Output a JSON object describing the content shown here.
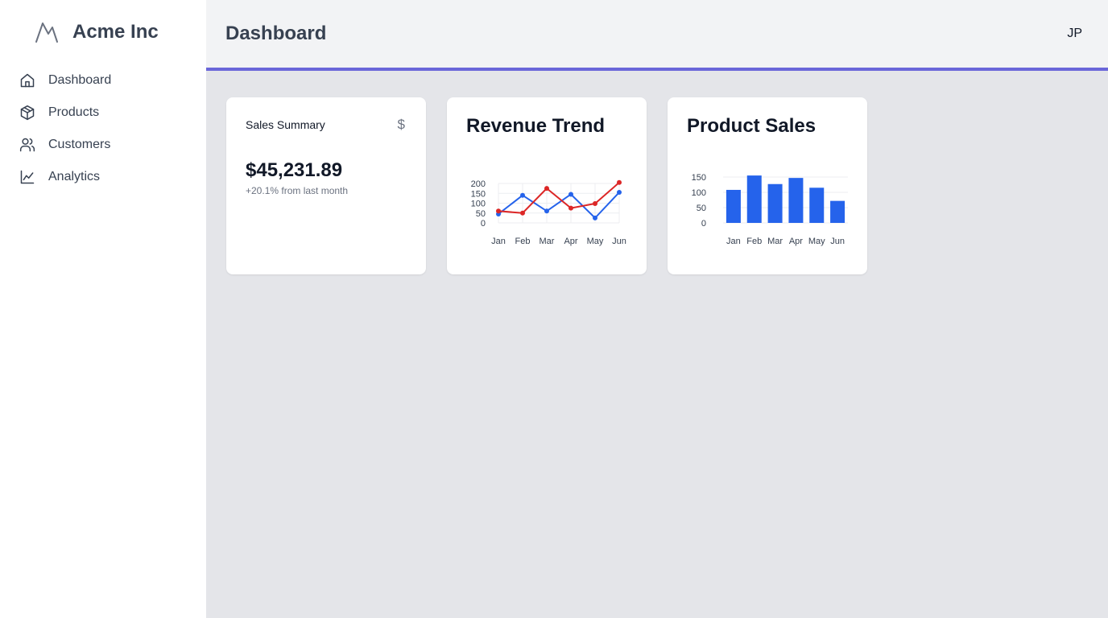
{
  "app": {
    "name": "Acme Inc"
  },
  "icons": {
    "brand": "mountain-icon",
    "dashboard": "home-icon",
    "products": "package-icon",
    "customers": "users-icon",
    "analytics": "line-chart-icon",
    "sales": "dollar-icon"
  },
  "sidebar": {
    "items": [
      {
        "label": "Dashboard"
      },
      {
        "label": "Products"
      },
      {
        "label": "Customers"
      },
      {
        "label": "Analytics"
      }
    ]
  },
  "header": {
    "title": "Dashboard",
    "user_initials": "JP",
    "accent_color": "#6a66d9"
  },
  "sales_summary": {
    "title": "Sales Summary",
    "currency_symbol": "$",
    "value": "$45,231.89",
    "change": "+20.1% from last month"
  },
  "chart_data": [
    {
      "type": "line",
      "title": "Revenue Trend",
      "categories": [
        "Jan",
        "Feb",
        "Mar",
        "Apr",
        "May",
        "Jun"
      ],
      "ylim": [
        0,
        200
      ],
      "yticks": [
        0,
        50,
        100,
        150,
        200
      ],
      "grid": true,
      "series": [
        {
          "color": "#2563eb",
          "values": [
            45,
            140,
            60,
            145,
            25,
            155
          ]
        },
        {
          "color": "#dc2626",
          "values": [
            60,
            50,
            175,
            75,
            98,
            205
          ]
        }
      ]
    },
    {
      "type": "bar",
      "title": "Product Sales",
      "categories": [
        "Jan",
        "Feb",
        "Mar",
        "Apr",
        "May",
        "Jun"
      ],
      "ylim": [
        0,
        150
      ],
      "yticks": [
        0,
        50,
        100,
        150
      ],
      "grid": true,
      "color": "#2563eb",
      "values": [
        108,
        155,
        127,
        147,
        115,
        72
      ]
    }
  ]
}
